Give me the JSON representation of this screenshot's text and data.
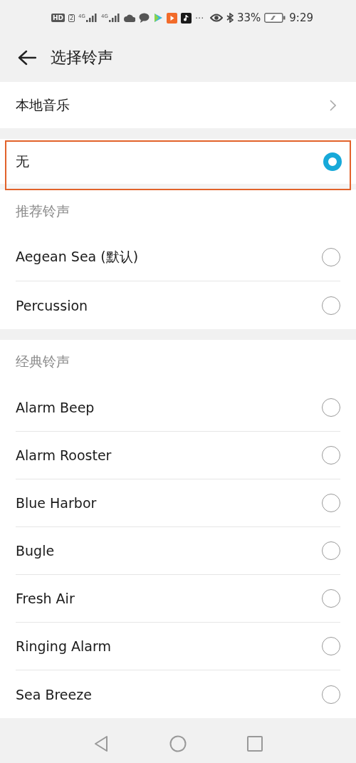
{
  "status_bar": {
    "hd_label": "HD",
    "sim_label": "2",
    "networks": [
      {
        "label": "4G"
      },
      {
        "label": "4G"
      }
    ],
    "more": "···",
    "battery_percent": "33%",
    "time": "9:29"
  },
  "header": {
    "title": "选择铃声"
  },
  "local_music": {
    "label": "本地音乐"
  },
  "none_option": {
    "label": "无",
    "selected": true,
    "highlighted": true
  },
  "groups": [
    {
      "title": "推荐铃声",
      "items": [
        {
          "label": "Aegean Sea (默认)",
          "selected": false
        },
        {
          "label": "Percussion",
          "selected": false
        }
      ]
    },
    {
      "title": "经典铃声",
      "items": [
        {
          "label": "Alarm Beep",
          "selected": false
        },
        {
          "label": "Alarm Rooster",
          "selected": false
        },
        {
          "label": "Blue Harbor",
          "selected": false
        },
        {
          "label": "Bugle",
          "selected": false
        },
        {
          "label": "Fresh Air",
          "selected": false
        },
        {
          "label": "Ringing Alarm",
          "selected": false
        },
        {
          "label": "Sea Breeze",
          "selected": false
        }
      ]
    }
  ]
}
